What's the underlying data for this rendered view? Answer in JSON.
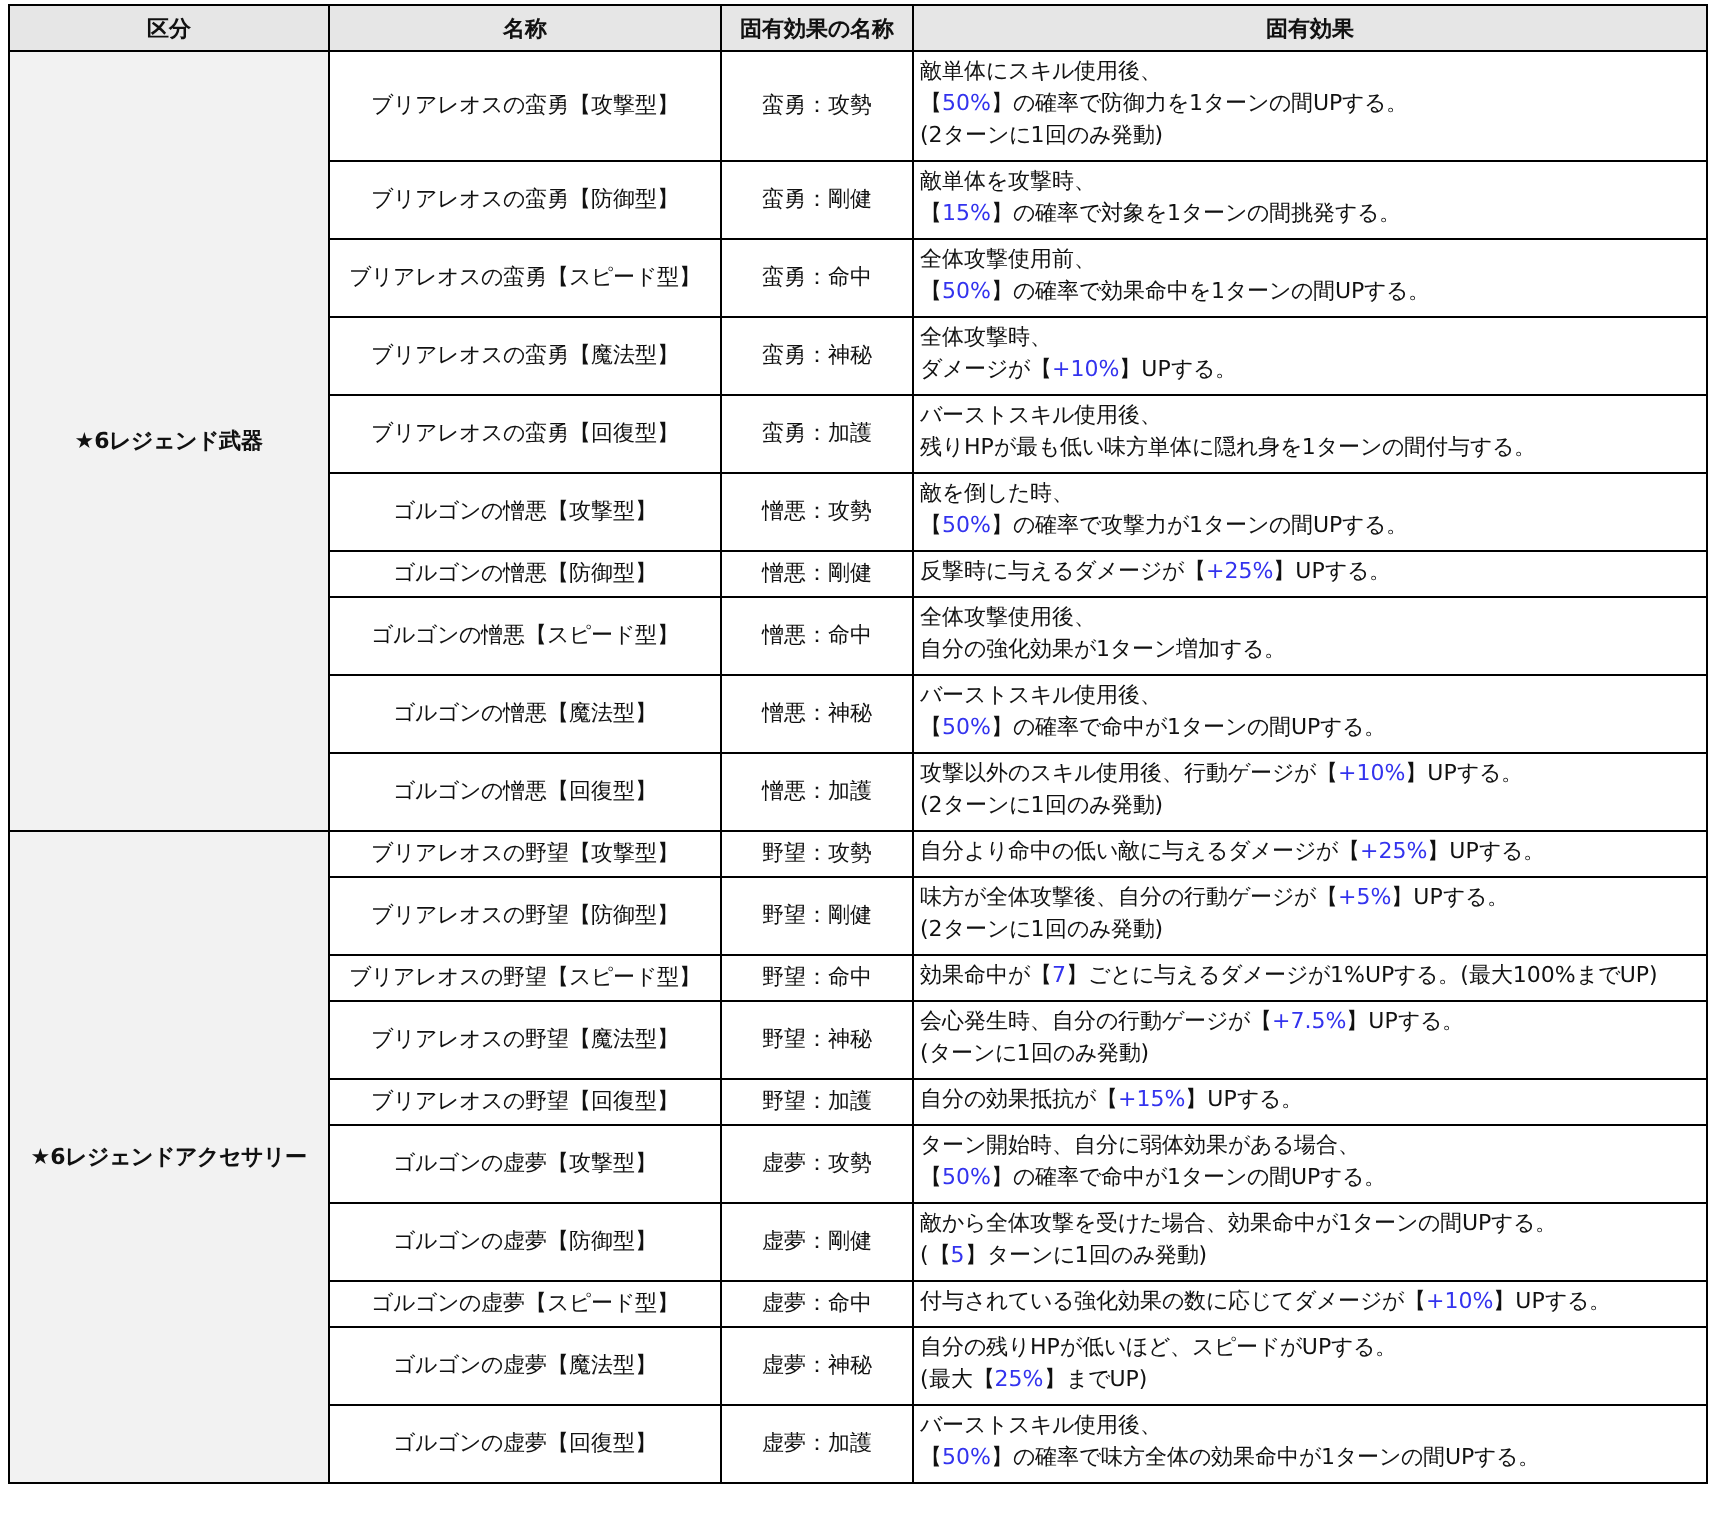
{
  "table": {
    "columns": [
      "区分",
      "名称",
      "固有効果の名称",
      "固有効果"
    ],
    "groups": [
      {
        "category": "★6レジェンド武器",
        "rows": [
          {
            "name": "ブリアレオスの蛮勇【攻撃型】",
            "effect_name": "蛮勇：攻勢",
            "effect": [
              [
                {
                  "text": "敵単体にスキル使用後、",
                  "highlighted": false
                }
              ],
              [
                {
                  "text": "【",
                  "highlighted": false
                },
                {
                  "text": "50%",
                  "highlighted": true
                },
                {
                  "text": "】の確率で防御力を1ターンの間UPする。",
                  "highlighted": false
                }
              ],
              [
                {
                  "text": "(2ターンに1回のみ発動)",
                  "highlighted": false
                }
              ]
            ]
          },
          {
            "name": "ブリアレオスの蛮勇【防御型】",
            "effect_name": "蛮勇：剛健",
            "effect": [
              [
                {
                  "text": "敵単体を攻撃時、",
                  "highlighted": false
                }
              ],
              [
                {
                  "text": "【",
                  "highlighted": false
                },
                {
                  "text": "15%",
                  "highlighted": true
                },
                {
                  "text": "】の確率で対象を1ターンの間挑発する。",
                  "highlighted": false
                }
              ]
            ]
          },
          {
            "name": "ブリアレオスの蛮勇【スピード型】",
            "effect_name": "蛮勇：命中",
            "effect": [
              [
                {
                  "text": "全体攻撃使用前、",
                  "highlighted": false
                }
              ],
              [
                {
                  "text": "【",
                  "highlighted": false
                },
                {
                  "text": "50%",
                  "highlighted": true
                },
                {
                  "text": "】の確率で効果命中を1ターンの間UPする。",
                  "highlighted": false
                }
              ]
            ]
          },
          {
            "name": "ブリアレオスの蛮勇【魔法型】",
            "effect_name": "蛮勇：神秘",
            "effect": [
              [
                {
                  "text": "全体攻撃時、",
                  "highlighted": false
                }
              ],
              [
                {
                  "text": "ダメージが【",
                  "highlighted": false
                },
                {
                  "text": "+10%",
                  "highlighted": true
                },
                {
                  "text": "】UPする。",
                  "highlighted": false
                }
              ]
            ]
          },
          {
            "name": "ブリアレオスの蛮勇【回復型】",
            "effect_name": "蛮勇：加護",
            "effect": [
              [
                {
                  "text": "バーストスキル使用後、",
                  "highlighted": false
                }
              ],
              [
                {
                  "text": "残りHPが最も低い味方単体に隠れ身を1ターンの間付与する。",
                  "highlighted": false
                }
              ]
            ]
          },
          {
            "name": "ゴルゴンの憎悪【攻撃型】",
            "effect_name": "憎悪：攻勢",
            "effect": [
              [
                {
                  "text": "敵を倒した時、",
                  "highlighted": false
                }
              ],
              [
                {
                  "text": "【",
                  "highlighted": false
                },
                {
                  "text": "50%",
                  "highlighted": true
                },
                {
                  "text": "】の確率で攻撃力が1ターンの間UPする。",
                  "highlighted": false
                }
              ]
            ]
          },
          {
            "name": "ゴルゴンの憎悪【防御型】",
            "effect_name": "憎悪：剛健",
            "effect": [
              [
                {
                  "text": "反撃時に与えるダメージが【",
                  "highlighted": false
                },
                {
                  "text": "+25%",
                  "highlighted": true
                },
                {
                  "text": "】UPする。",
                  "highlighted": false
                }
              ]
            ]
          },
          {
            "name": "ゴルゴンの憎悪【スピード型】",
            "effect_name": "憎悪：命中",
            "effect": [
              [
                {
                  "text": "全体攻撃使用後、",
                  "highlighted": false
                }
              ],
              [
                {
                  "text": "自分の強化効果が1ターン増加する。",
                  "highlighted": false
                }
              ]
            ]
          },
          {
            "name": "ゴルゴンの憎悪【魔法型】",
            "effect_name": "憎悪：神秘",
            "effect": [
              [
                {
                  "text": "バーストスキル使用後、",
                  "highlighted": false
                }
              ],
              [
                {
                  "text": "【",
                  "highlighted": false
                },
                {
                  "text": "50%",
                  "highlighted": true
                },
                {
                  "text": "】の確率で命中が1ターンの間UPする。",
                  "highlighted": false
                }
              ]
            ]
          },
          {
            "name": "ゴルゴンの憎悪【回復型】",
            "effect_name": "憎悪：加護",
            "effect": [
              [
                {
                  "text": "攻撃以外のスキル使用後、行動ゲージが【",
                  "highlighted": false
                },
                {
                  "text": "+10%",
                  "highlighted": true
                },
                {
                  "text": "】UPする。",
                  "highlighted": false
                }
              ],
              [
                {
                  "text": "(2ターンに1回のみ発動)",
                  "highlighted": false
                }
              ]
            ]
          }
        ]
      },
      {
        "category": "★6レジェンドアクセサリー",
        "rows": [
          {
            "name": "ブリアレオスの野望【攻撃型】",
            "effect_name": "野望：攻勢",
            "effect": [
              [
                {
                  "text": "自分より命中の低い敵に与えるダメージが【",
                  "highlighted": false
                },
                {
                  "text": "+25%",
                  "highlighted": true
                },
                {
                  "text": "】UPする。",
                  "highlighted": false
                }
              ]
            ]
          },
          {
            "name": "ブリアレオスの野望【防御型】",
            "effect_name": "野望：剛健",
            "effect": [
              [
                {
                  "text": "味方が全体攻撃後、自分の行動ゲージが【",
                  "highlighted": false
                },
                {
                  "text": "+5%",
                  "highlighted": true
                },
                {
                  "text": "】UPする。",
                  "highlighted": false
                }
              ],
              [
                {
                  "text": "(2ターンに1回のみ発動)",
                  "highlighted": false
                }
              ]
            ]
          },
          {
            "name": "ブリアレオスの野望【スピード型】",
            "effect_name": "野望：命中",
            "effect": [
              [
                {
                  "text": "効果命中が【",
                  "highlighted": false
                },
                {
                  "text": "7",
                  "highlighted": true
                },
                {
                  "text": "】ごとに与えるダメージが1%UPする。(最大100%までUP)",
                  "highlighted": false
                }
              ]
            ]
          },
          {
            "name": "ブリアレオスの野望【魔法型】",
            "effect_name": "野望：神秘",
            "effect": [
              [
                {
                  "text": "会心発生時、自分の行動ゲージが【",
                  "highlighted": false
                },
                {
                  "text": "+7.5%",
                  "highlighted": true
                },
                {
                  "text": "】UPする。",
                  "highlighted": false
                }
              ],
              [
                {
                  "text": "(ターンに1回のみ発動)",
                  "highlighted": false
                }
              ]
            ]
          },
          {
            "name": "ブリアレオスの野望【回復型】",
            "effect_name": "野望：加護",
            "effect": [
              [
                {
                  "text": "自分の効果抵抗が【",
                  "highlighted": false
                },
                {
                  "text": "+15%",
                  "highlighted": true
                },
                {
                  "text": "】UPする。",
                  "highlighted": false
                }
              ]
            ]
          },
          {
            "name": "ゴルゴンの虚夢【攻撃型】",
            "effect_name": "虚夢：攻勢",
            "effect": [
              [
                {
                  "text": "ターン開始時、自分に弱体効果がある場合、",
                  "highlighted": false
                }
              ],
              [
                {
                  "text": "【",
                  "highlighted": false
                },
                {
                  "text": "50%",
                  "highlighted": true
                },
                {
                  "text": "】の確率で命中が1ターンの間UPする。",
                  "highlighted": false
                }
              ]
            ]
          },
          {
            "name": "ゴルゴンの虚夢【防御型】",
            "effect_name": "虚夢：剛健",
            "effect": [
              [
                {
                  "text": "敵から全体攻撃を受けた場合、効果命中が1ターンの間UPする。",
                  "highlighted": false
                }
              ],
              [
                {
                  "text": "(【",
                  "highlighted": false
                },
                {
                  "text": "5",
                  "highlighted": true
                },
                {
                  "text": "】ターンに1回のみ発動)",
                  "highlighted": false
                }
              ]
            ]
          },
          {
            "name": "ゴルゴンの虚夢【スピード型】",
            "effect_name": "虚夢：命中",
            "effect": [
              [
                {
                  "text": "付与されている強化効果の数に応じてダメージが【",
                  "highlighted": false
                },
                {
                  "text": "+10%",
                  "highlighted": true
                },
                {
                  "text": "】UPする。",
                  "highlighted": false
                }
              ]
            ]
          },
          {
            "name": "ゴルゴンの虚夢【魔法型】",
            "effect_name": "虚夢：神秘",
            "effect": [
              [
                {
                  "text": "自分の残りHPが低いほど、スピードがUPする。",
                  "highlighted": false
                }
              ],
              [
                {
                  "text": "(最大【",
                  "highlighted": false
                },
                {
                  "text": "25%",
                  "highlighted": true
                },
                {
                  "text": "】までUP)",
                  "highlighted": false
                }
              ]
            ]
          },
          {
            "name": "ゴルゴンの虚夢【回復型】",
            "effect_name": "虚夢：加護",
            "effect": [
              [
                {
                  "text": "バーストスキル使用後、",
                  "highlighted": false
                }
              ],
              [
                {
                  "text": "【",
                  "highlighted": false
                },
                {
                  "text": "50%",
                  "highlighted": true
                },
                {
                  "text": "】の確率で味方全体の効果命中が1ターンの間UPする。",
                  "highlighted": false
                }
              ]
            ]
          }
        ]
      }
    ]
  }
}
